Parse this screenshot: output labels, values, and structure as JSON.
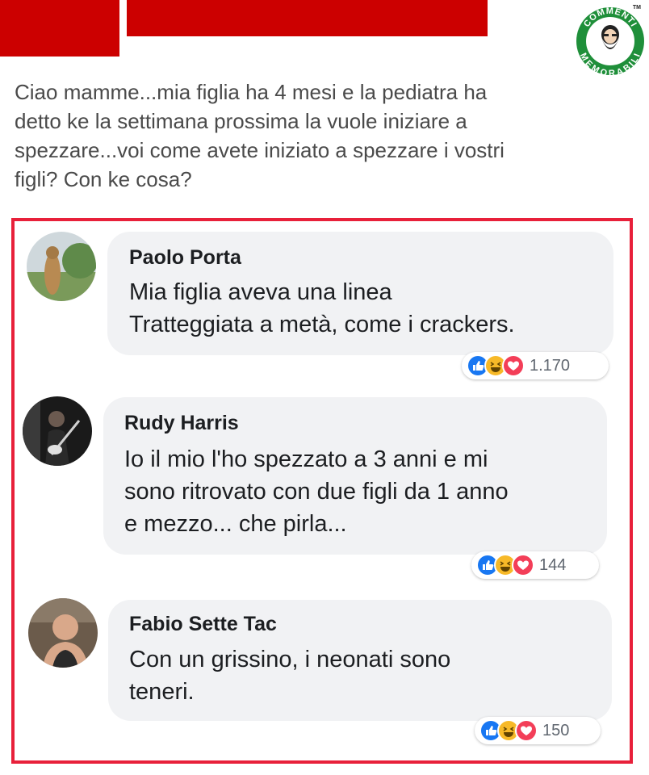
{
  "logo": {
    "top_text": "COMMENTI",
    "bottom_text": "MEMORABILI",
    "tm": "TM",
    "icon": "bearded-face-icon"
  },
  "post": {
    "lines": [
      "Ciao mamme...mia figlia ha 4 mesi e la pediatra ha",
      "detto ke la settimana prossima la vuole iniziare a",
      "spezzare...voi come avete iniziato a spezzare i vostri",
      "figli? Con ke cosa?"
    ]
  },
  "comments": [
    {
      "author": "Paolo Porta",
      "lines": [
        "Mia figlia aveva una linea",
        "Tratteggiata a metà, come i crackers."
      ],
      "reaction_count": "1.170",
      "reactions": [
        "like-icon",
        "haha-icon",
        "love-icon"
      ]
    },
    {
      "author": "Rudy Harris",
      "lines": [
        "Io il mio l'ho spezzato a 3 anni e mi",
        "sono ritrovato con due figli da 1 anno",
        "e mezzo... che pirla..."
      ],
      "reaction_count": "144",
      "reactions": [
        "like-icon",
        "haha-icon",
        "love-icon"
      ]
    },
    {
      "author": "Fabio Sette Tac",
      "lines": [
        "Con un grissino, i neonati sono",
        "teneri."
      ],
      "reaction_count": "150",
      "reactions": [
        "like-icon",
        "haha-icon",
        "love-icon"
      ]
    }
  ],
  "colors": {
    "redaction": "#cc0000",
    "frame": "#e8203a",
    "bubble": "#f1f2f4",
    "like": "#1877f2",
    "haha": "#f7b928",
    "love": "#f33e58",
    "logo_green": "#1f8f3a"
  }
}
